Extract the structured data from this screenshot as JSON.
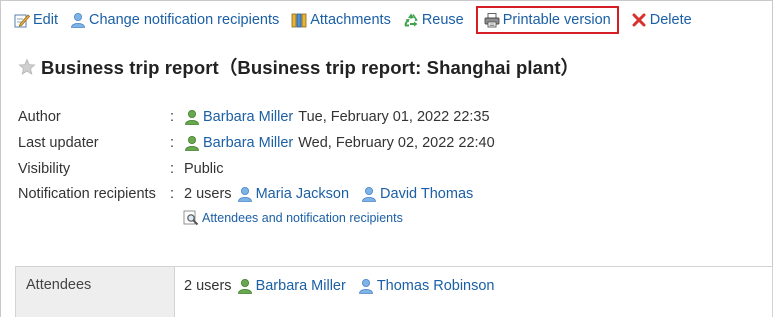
{
  "toolbar": {
    "edit": "Edit",
    "change_recipients": "Change notification recipients",
    "attachments": "Attachments",
    "reuse": "Reuse",
    "printable": "Printable version",
    "delete": "Delete"
  },
  "title": "Business trip report（Business trip report: Shanghai plant）",
  "properties": {
    "author": {
      "label": "Author",
      "colon": ":",
      "user": "Barbara Miller",
      "date": "Tue, February 01, 2022 22:35"
    },
    "last_updater": {
      "label": "Last updater",
      "colon": ":",
      "user": "Barbara Miller",
      "date": "Wed, February 02, 2022 22:40"
    },
    "visibility": {
      "label": "Visibility",
      "colon": ":",
      "value": "Public"
    },
    "recipients": {
      "label": "Notification recipients",
      "colon": ":",
      "count": "2 users",
      "users": [
        "Maria Jackson",
        "David Thomas"
      ]
    },
    "attendees_link": "Attendees and notification recipients"
  },
  "table": {
    "attendees_label": "Attendees",
    "attendees_count": "2 users",
    "attendees": [
      "Barbara Miller",
      "Thomas Robinson"
    ]
  },
  "colors": {
    "link": "#1b5fa5",
    "highlight_box": "#d51f24",
    "user_icon_primary": "#6aa84f",
    "user_icon_secondary": "#7fb2e5"
  },
  "icons": {
    "edit": "edit-icon",
    "change_recipients": "person-icon",
    "attachments": "books-icon",
    "reuse": "recycle-icon",
    "printable": "printer-icon",
    "delete": "delete-x-icon",
    "favorite": "star-icon"
  }
}
